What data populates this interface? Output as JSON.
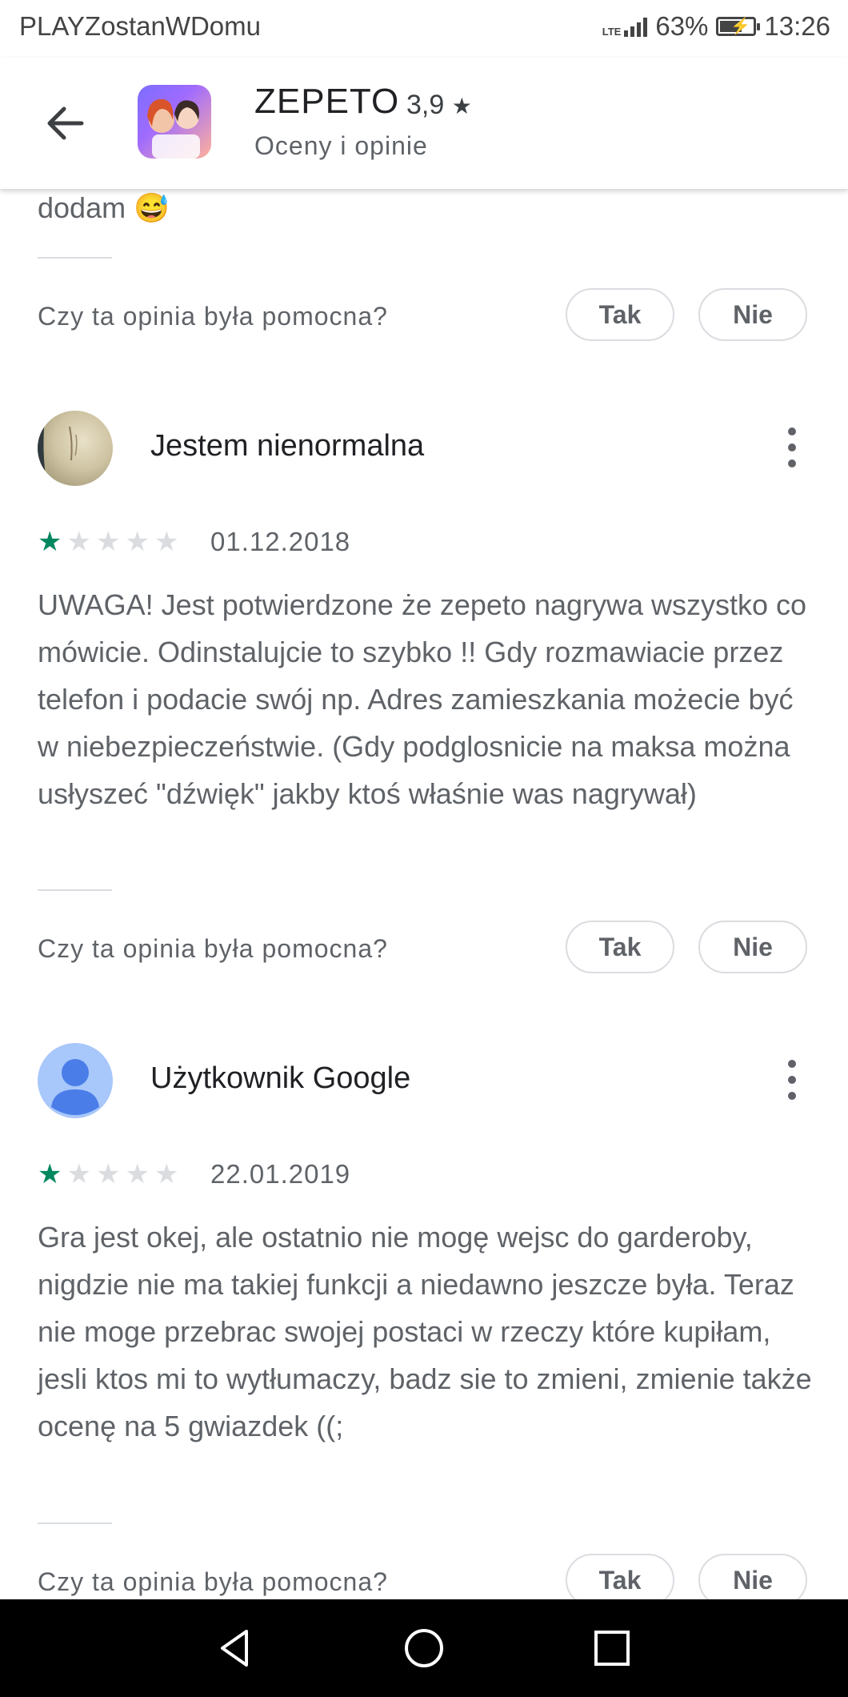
{
  "status_bar": {
    "carrier": "PLAYZostanWDomu",
    "network": "LTE",
    "battery": "63%",
    "time": "13:26"
  },
  "header": {
    "app_name": "ZEPETO",
    "rating": "3,9",
    "subtitle": "Oceny i opinie"
  },
  "top_fragment": {
    "text": "dodam 😅",
    "helpful_question": "Czy ta opinia była pomocna?",
    "yes_label": "Tak",
    "no_label": "Nie"
  },
  "reviews": [
    {
      "author": "Jestem nienormalna",
      "rating": 1,
      "max_rating": 5,
      "date": "01.12.2018",
      "text": "UWAGA! Jest potwierdzone że zepeto nagrywa wszystko co mówicie. Odinstalujcie to szybko !! Gdy rozmawiacie przez telefon i podacie swój np. Adres zamieszkania możecie być w niebezpieczeństwie. (Gdy podglosnicie na maksa można usłyszeć \"dźwięk\" jakby ktoś właśnie was nagrywał)",
      "helpful_question": "Czy ta opinia była pomocna?",
      "yes_label": "Tak",
      "no_label": "Nie"
    },
    {
      "author": "Użytkownik Google",
      "rating": 1,
      "max_rating": 5,
      "date": "22.01.2019",
      "text": "Gra jest okej, ale ostatnio nie mogę wejsc do garderoby, nigdzie nie ma takiej funkcji a niedawno jeszcze była. Teraz nie moge przebrac swojej postaci w rzeczy które kupiłam, jesli ktos mi to wytłumaczy, badz sie to zmieni, zmienie także ocenę na 5 gwiazdek ((;",
      "helpful_question": "Czy ta opinia była pomocna?",
      "yes_label": "Tak",
      "no_label": "Nie"
    }
  ],
  "icons": {
    "back": "arrow-back-icon",
    "more": "more-vert-icon",
    "star": "star-icon",
    "nav_back": "triangle-back-icon",
    "nav_home": "circle-home-icon",
    "nav_recents": "square-recents-icon"
  },
  "colors": {
    "star_filled": "#01875f",
    "star_empty": "#dadce0",
    "text_secondary": "#5f6368",
    "divider": "#dadce0",
    "nav_bar": "#000000"
  }
}
